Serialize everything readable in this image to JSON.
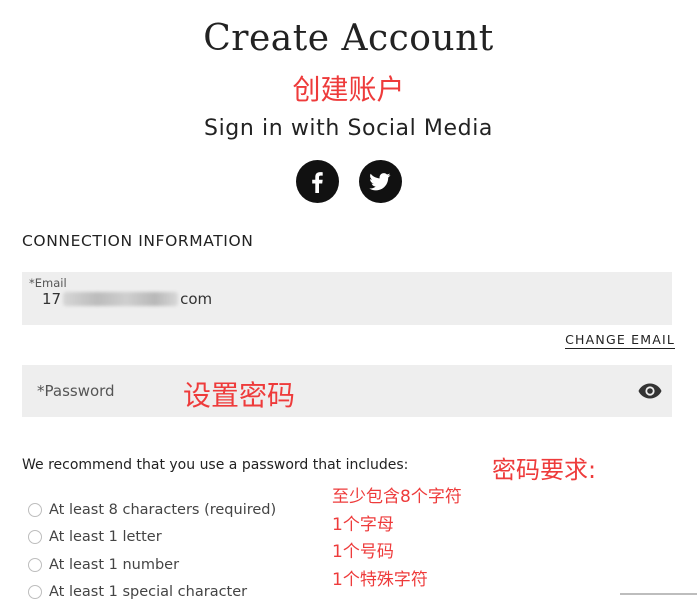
{
  "header": {
    "title": "Create Account",
    "social_heading": "Sign in with Social Media",
    "social": [
      {
        "name": "facebook-icon",
        "glyph": "f"
      },
      {
        "name": "twitter-icon",
        "glyph": "twitter-bird"
      }
    ]
  },
  "connection": {
    "heading": "CONNECTION INFORMATION",
    "email_label": "*Email",
    "email_prefix": "17",
    "email_suffix": "com",
    "change_email": "CHANGE EMAIL",
    "password_placeholder": "*Password"
  },
  "requirements": {
    "intro": "We recommend that you use a password that includes:",
    "items": [
      "At least 8 characters (required)",
      "At least 1 letter",
      "At least 1 number",
      "At least 1 special character"
    ]
  },
  "annotations": {
    "title": "创建账户",
    "password": "设置密码",
    "requirements": "密码要求:",
    "items": [
      "至少包含8个字符",
      "1个字母",
      "1个号码",
      "1个特殊字符"
    ],
    "color": "#ee3b3b"
  },
  "colors": {
    "field_bg": "#eeeeee",
    "social_bg": "#111111",
    "text": "#222222"
  }
}
